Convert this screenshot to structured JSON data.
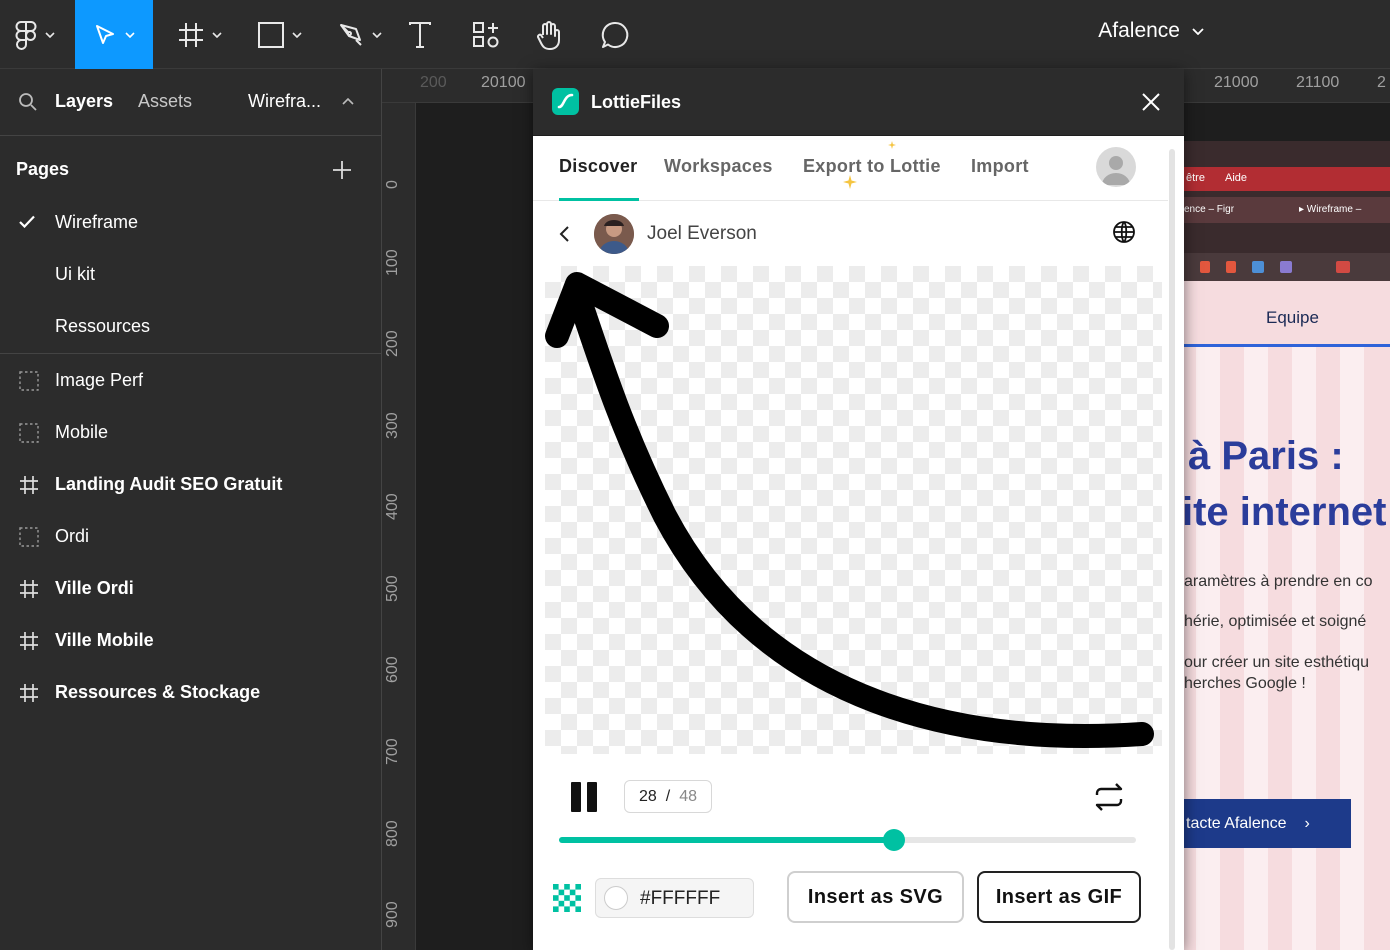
{
  "toolbar": {
    "team_name": "Afalence"
  },
  "left_panel": {
    "tabs": {
      "layers": "Layers",
      "assets": "Assets",
      "current_page": "Wirefra..."
    },
    "pages_title": "Pages",
    "pages": [
      {
        "label": "Wireframe",
        "active": true
      },
      {
        "label": "Ui kit"
      },
      {
        "label": "Ressources"
      }
    ],
    "frames": [
      {
        "label": "Image Perf",
        "icon": "section-icon",
        "bold": false
      },
      {
        "label": "Mobile",
        "icon": "section-icon",
        "bold": false
      },
      {
        "label": "Landing Audit SEO Gratuit",
        "icon": "frame-icon",
        "bold": true
      },
      {
        "label": "Ordi",
        "icon": "section-icon",
        "bold": false
      },
      {
        "label": "Ville Ordi",
        "icon": "frame-icon",
        "bold": true
      },
      {
        "label": "Ville Mobile",
        "icon": "frame-icon",
        "bold": true
      },
      {
        "label": "Ressources & Stockage",
        "icon": "frame-icon",
        "bold": true
      }
    ]
  },
  "rulers": {
    "horizontal": [
      "200",
      "20100",
      "21000",
      "21100",
      "2"
    ],
    "vertical": [
      "0",
      "100",
      "200",
      "300",
      "400",
      "500",
      "600",
      "700",
      "800",
      "900"
    ]
  },
  "site_preview": {
    "menu": [
      "être",
      "Aide"
    ],
    "tabs": [
      "ence – Figr",
      "▸ Wireframe –"
    ],
    "nav_item": "Equipe",
    "heading_line1": "à Paris :",
    "heading_line2": "ite internet",
    "paragraphs": [
      "aramètres à prendre en co",
      "hérie, optimisée et soigné",
      "our créer un site esthétiqu",
      "herches Google !"
    ],
    "cta": "tacte Afalence"
  },
  "plugin": {
    "title": "LottieFiles",
    "tabs": [
      "Discover",
      "Workspaces",
      "Export to Lottie",
      "Import"
    ],
    "active_tab": "Discover",
    "author": "Joel Everson",
    "current_frame": "28",
    "frame_separator": "/",
    "total_frames": "48",
    "progress": 0.58,
    "background_color": "#FFFFFF",
    "insert_svg": "Insert as SVG",
    "insert_gif": "Insert as GIF",
    "accent": "#00c1a2"
  }
}
